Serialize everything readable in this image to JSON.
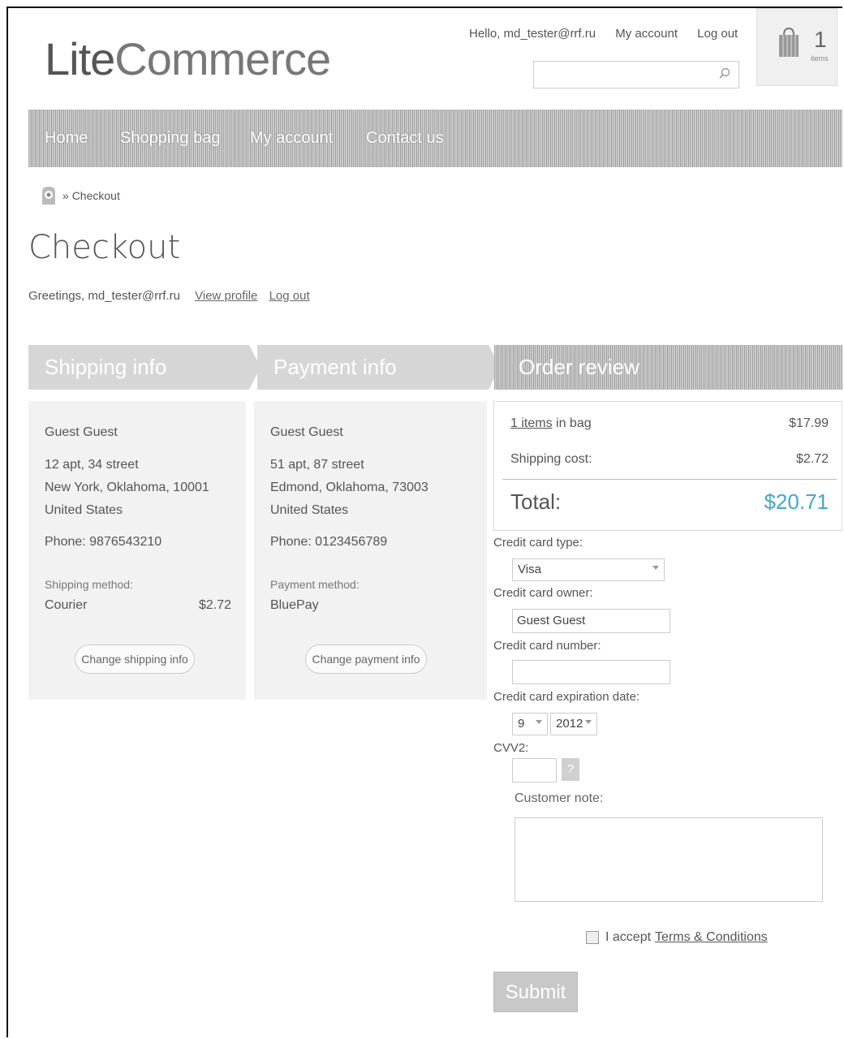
{
  "header": {
    "logo_lite": "Lite",
    "logo_commerce": "Commerce",
    "hello": "Hello, md_tester@rrf.ru",
    "my_account": "My account",
    "log_out": "Log out",
    "search_placeholder": "",
    "cart_count": "1",
    "cart_items_label": "items"
  },
  "nav": {
    "items": [
      "Home",
      "Shopping bag",
      "My account",
      "Contact us"
    ]
  },
  "breadcrumb": {
    "current": "Checkout"
  },
  "page_title": "Checkout",
  "greeting": {
    "text": "Greetings, md_tester@rrf.ru",
    "view_profile": "View profile",
    "log_out": "Log out"
  },
  "steps": [
    "Shipping info",
    "Payment info",
    "Order review"
  ],
  "shipping": {
    "name": "Guest Guest",
    "address1": "12 apt, 34 street",
    "address2": "New York, Oklahoma, 10001",
    "country": "United States",
    "phone": "Phone: 9876543210",
    "method_label": "Shipping method:",
    "method": "Courier",
    "method_cost": "$2.72",
    "change_button": "Change shipping info"
  },
  "payment": {
    "name": "Guest Guest",
    "address1": "51 apt, 87 street",
    "address2": "Edmond, Oklahoma, 73003",
    "country": "United States",
    "phone": "Phone: 0123456789",
    "method_label": "Payment method:",
    "method": "BluePay",
    "change_button": "Change payment info"
  },
  "review": {
    "items_link": "1 items",
    "items_suffix": " in bag",
    "items_total": "$17.99",
    "shipping_label": "Shipping cost:",
    "shipping_value": "$2.72",
    "total_label": "Total:",
    "total_value": "$20.71"
  },
  "form": {
    "card_type_label": "Credit card type:",
    "card_type_value": "Visa",
    "card_owner_label": "Credit card owner:",
    "card_owner_value": "Guest Guest",
    "card_number_label": "Credit card number:",
    "card_number_value": "",
    "expiration_label": "Credit card expiration date:",
    "exp_month": "9",
    "exp_year": "2012",
    "cvv_label": "CVV2:",
    "cvv_help": "?",
    "note_label": "Customer note:",
    "accept_text": "I accept",
    "terms_link": "Terms & Conditions",
    "submit": "Submit"
  }
}
